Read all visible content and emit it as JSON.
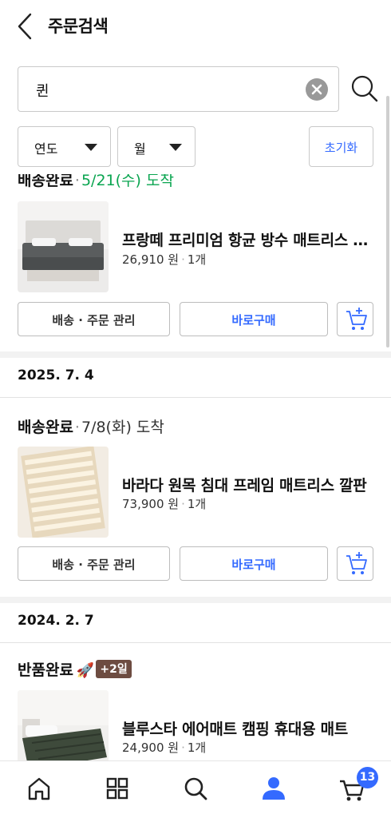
{
  "header": {
    "title": "주문검색"
  },
  "search": {
    "value": "퀸"
  },
  "filters": {
    "year_label": "연도",
    "month_label": "월",
    "reset_label": "초기화"
  },
  "orders": [
    {
      "status": "배송완료",
      "arrival": "5/21(수) 도착",
      "product_name": "프랑떼 프리미엄 항균 방수 매트리스 커버",
      "price": "26,910 원",
      "qty": "1개",
      "manage_label": "배송 · 주문 관리",
      "rebuy_label": "바로구매"
    },
    {
      "date": "2025. 7. 4",
      "status": "배송완료",
      "arrival": "7/8(화) 도착",
      "product_name": "바라다 원목 침대 프레임 매트리스 깔판",
      "price": "73,900 원",
      "qty": "1개",
      "manage_label": "배송 · 주문 관리",
      "rebuy_label": "바로구매"
    },
    {
      "date": "2024. 2. 7",
      "status": "반품완료",
      "badge": "+2일",
      "product_name": "블루스타 에어매트 캠핑 휴대용 매트",
      "price": "24,900 원",
      "qty": "1개"
    }
  ],
  "bottom_nav": {
    "cart_count": "13"
  },
  "colors": {
    "accent": "#346aff",
    "green": "#0aa550",
    "badge": "#6d4c41"
  },
  "icons": [
    "back-icon",
    "clear-icon",
    "search-icon",
    "caret-down-icon",
    "cart-add-icon",
    "home-icon",
    "category-icon",
    "person-icon",
    "cart-icon",
    "rocket-icon"
  ]
}
